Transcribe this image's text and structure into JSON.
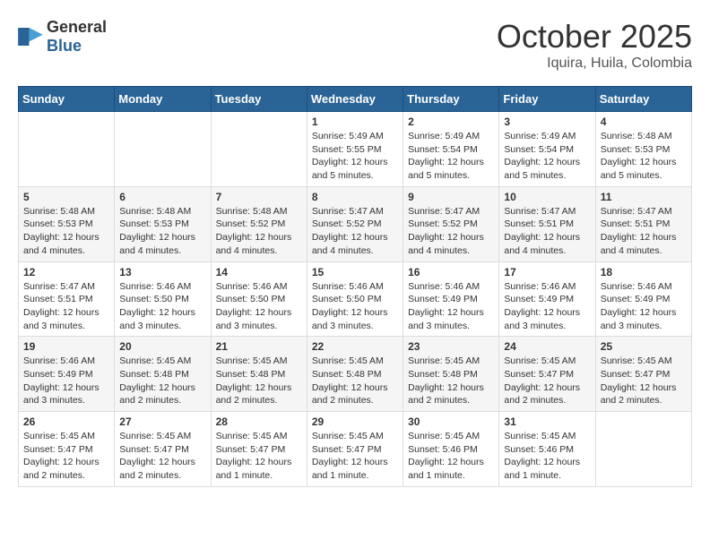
{
  "header": {
    "logo_general": "General",
    "logo_blue": "Blue",
    "month": "October 2025",
    "location": "Iquira, Huila, Colombia"
  },
  "weekdays": [
    "Sunday",
    "Monday",
    "Tuesday",
    "Wednesday",
    "Thursday",
    "Friday",
    "Saturday"
  ],
  "weeks": [
    [
      {
        "day": "",
        "info": ""
      },
      {
        "day": "",
        "info": ""
      },
      {
        "day": "",
        "info": ""
      },
      {
        "day": "1",
        "info": "Sunrise: 5:49 AM\nSunset: 5:55 PM\nDaylight: 12 hours\nand 5 minutes."
      },
      {
        "day": "2",
        "info": "Sunrise: 5:49 AM\nSunset: 5:54 PM\nDaylight: 12 hours\nand 5 minutes."
      },
      {
        "day": "3",
        "info": "Sunrise: 5:49 AM\nSunset: 5:54 PM\nDaylight: 12 hours\nand 5 minutes."
      },
      {
        "day": "4",
        "info": "Sunrise: 5:48 AM\nSunset: 5:53 PM\nDaylight: 12 hours\nand 5 minutes."
      }
    ],
    [
      {
        "day": "5",
        "info": "Sunrise: 5:48 AM\nSunset: 5:53 PM\nDaylight: 12 hours\nand 4 minutes."
      },
      {
        "day": "6",
        "info": "Sunrise: 5:48 AM\nSunset: 5:53 PM\nDaylight: 12 hours\nand 4 minutes."
      },
      {
        "day": "7",
        "info": "Sunrise: 5:48 AM\nSunset: 5:52 PM\nDaylight: 12 hours\nand 4 minutes."
      },
      {
        "day": "8",
        "info": "Sunrise: 5:47 AM\nSunset: 5:52 PM\nDaylight: 12 hours\nand 4 minutes."
      },
      {
        "day": "9",
        "info": "Sunrise: 5:47 AM\nSunset: 5:52 PM\nDaylight: 12 hours\nand 4 minutes."
      },
      {
        "day": "10",
        "info": "Sunrise: 5:47 AM\nSunset: 5:51 PM\nDaylight: 12 hours\nand 4 minutes."
      },
      {
        "day": "11",
        "info": "Sunrise: 5:47 AM\nSunset: 5:51 PM\nDaylight: 12 hours\nand 4 minutes."
      }
    ],
    [
      {
        "day": "12",
        "info": "Sunrise: 5:47 AM\nSunset: 5:51 PM\nDaylight: 12 hours\nand 3 minutes."
      },
      {
        "day": "13",
        "info": "Sunrise: 5:46 AM\nSunset: 5:50 PM\nDaylight: 12 hours\nand 3 minutes."
      },
      {
        "day": "14",
        "info": "Sunrise: 5:46 AM\nSunset: 5:50 PM\nDaylight: 12 hours\nand 3 minutes."
      },
      {
        "day": "15",
        "info": "Sunrise: 5:46 AM\nSunset: 5:50 PM\nDaylight: 12 hours\nand 3 minutes."
      },
      {
        "day": "16",
        "info": "Sunrise: 5:46 AM\nSunset: 5:49 PM\nDaylight: 12 hours\nand 3 minutes."
      },
      {
        "day": "17",
        "info": "Sunrise: 5:46 AM\nSunset: 5:49 PM\nDaylight: 12 hours\nand 3 minutes."
      },
      {
        "day": "18",
        "info": "Sunrise: 5:46 AM\nSunset: 5:49 PM\nDaylight: 12 hours\nand 3 minutes."
      }
    ],
    [
      {
        "day": "19",
        "info": "Sunrise: 5:46 AM\nSunset: 5:49 PM\nDaylight: 12 hours\nand 3 minutes."
      },
      {
        "day": "20",
        "info": "Sunrise: 5:45 AM\nSunset: 5:48 PM\nDaylight: 12 hours\nand 2 minutes."
      },
      {
        "day": "21",
        "info": "Sunrise: 5:45 AM\nSunset: 5:48 PM\nDaylight: 12 hours\nand 2 minutes."
      },
      {
        "day": "22",
        "info": "Sunrise: 5:45 AM\nSunset: 5:48 PM\nDaylight: 12 hours\nand 2 minutes."
      },
      {
        "day": "23",
        "info": "Sunrise: 5:45 AM\nSunset: 5:48 PM\nDaylight: 12 hours\nand 2 minutes."
      },
      {
        "day": "24",
        "info": "Sunrise: 5:45 AM\nSunset: 5:47 PM\nDaylight: 12 hours\nand 2 minutes."
      },
      {
        "day": "25",
        "info": "Sunrise: 5:45 AM\nSunset: 5:47 PM\nDaylight: 12 hours\nand 2 minutes."
      }
    ],
    [
      {
        "day": "26",
        "info": "Sunrise: 5:45 AM\nSunset: 5:47 PM\nDaylight: 12 hours\nand 2 minutes."
      },
      {
        "day": "27",
        "info": "Sunrise: 5:45 AM\nSunset: 5:47 PM\nDaylight: 12 hours\nand 2 minutes."
      },
      {
        "day": "28",
        "info": "Sunrise: 5:45 AM\nSunset: 5:47 PM\nDaylight: 12 hours\nand 1 minute."
      },
      {
        "day": "29",
        "info": "Sunrise: 5:45 AM\nSunset: 5:47 PM\nDaylight: 12 hours\nand 1 minute."
      },
      {
        "day": "30",
        "info": "Sunrise: 5:45 AM\nSunset: 5:46 PM\nDaylight: 12 hours\nand 1 minute."
      },
      {
        "day": "31",
        "info": "Sunrise: 5:45 AM\nSunset: 5:46 PM\nDaylight: 12 hours\nand 1 minute."
      },
      {
        "day": "",
        "info": ""
      }
    ]
  ]
}
